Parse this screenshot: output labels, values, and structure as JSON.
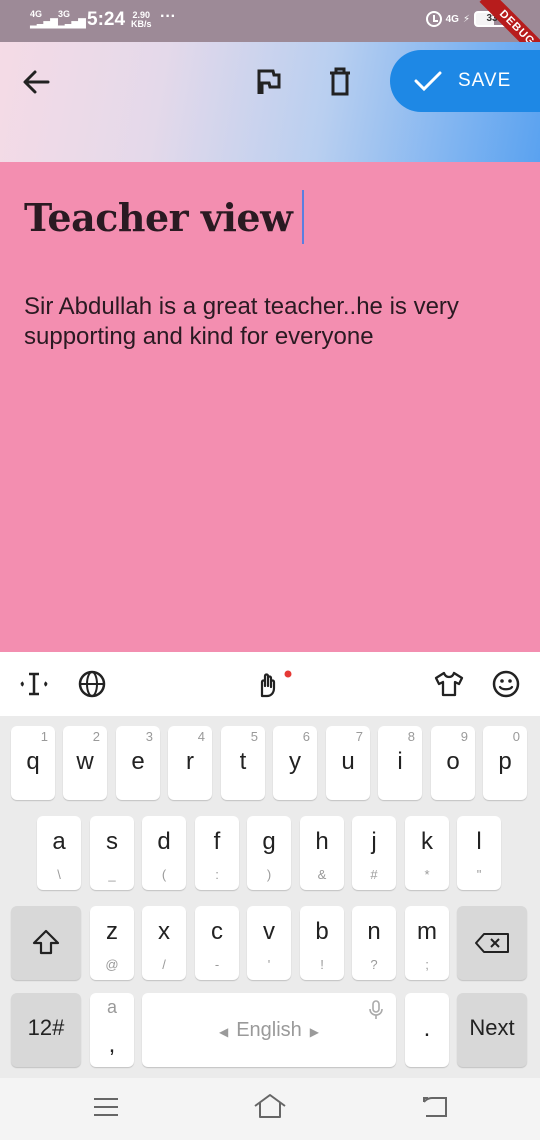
{
  "status_bar": {
    "signal1": "4G",
    "signal2": "3G",
    "time": "5:24",
    "speed_value": "2.90",
    "speed_unit": "KB/s",
    "more": "···",
    "network": "4G",
    "battery": "33",
    "debug_banner": "DEBUG"
  },
  "appbar": {
    "back_icon": "arrow-left-icon",
    "flag_icon": "flag-icon",
    "delete_icon": "trash-icon",
    "save_label": "SAVE",
    "save_icon": "check-icon",
    "save_color": "#1e88e5"
  },
  "note": {
    "title": "Teacher view",
    "body": "Sir Abdullah is a great teacher..he is very supporting and kind for everyone",
    "background": "#f38eb0"
  },
  "keyboard": {
    "toolbar": [
      "text-cursor-icon",
      "globe-icon",
      "hand-gesture-icon",
      "shirt-icon",
      "smiley-icon"
    ],
    "row1": [
      {
        "key": "q",
        "hint": "1"
      },
      {
        "key": "w",
        "hint": "2"
      },
      {
        "key": "e",
        "hint": "3"
      },
      {
        "key": "r",
        "hint": "4"
      },
      {
        "key": "t",
        "hint": "5"
      },
      {
        "key": "y",
        "hint": "6"
      },
      {
        "key": "u",
        "hint": "7"
      },
      {
        "key": "i",
        "hint": "8"
      },
      {
        "key": "o",
        "hint": "9"
      },
      {
        "key": "p",
        "hint": "0"
      }
    ],
    "row2": [
      {
        "key": "a",
        "sub": "\\"
      },
      {
        "key": "s",
        "sub": "_"
      },
      {
        "key": "d",
        "sub": "("
      },
      {
        "key": "f",
        "sub": ":"
      },
      {
        "key": "g",
        "sub": ")"
      },
      {
        "key": "h",
        "sub": "&"
      },
      {
        "key": "j",
        "sub": "#"
      },
      {
        "key": "k",
        "sub": "*"
      },
      {
        "key": "l",
        "sub": "\""
      }
    ],
    "row3": [
      {
        "key": "z",
        "sub": "@"
      },
      {
        "key": "x",
        "sub": "/"
      },
      {
        "key": "c",
        "sub": "-"
      },
      {
        "key": "v",
        "sub": "'"
      },
      {
        "key": "b",
        "sub": "!"
      },
      {
        "key": "n",
        "sub": "?"
      },
      {
        "key": "m",
        "sub": ";"
      }
    ],
    "num_label": "12#",
    "comma_top": "a",
    "comma_label": ",",
    "space_label": "English",
    "period_label": ".",
    "next_label": "Next"
  }
}
